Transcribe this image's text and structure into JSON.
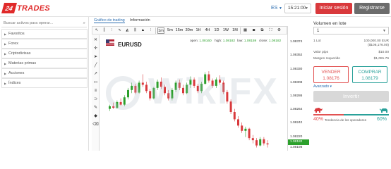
{
  "header": {
    "logo_mark": "24",
    "logo_text": "TRADES",
    "language": "ES",
    "time": "15:21:00",
    "login_label": "Iniciar sesión",
    "register_label": "Registrarse"
  },
  "sidebar": {
    "search_placeholder": "Buscar activos para operar...",
    "categories": [
      "Favoritos",
      "Forex",
      "Criptodivisas",
      "Materias primas",
      "Acciones",
      "Índices"
    ]
  },
  "chart": {
    "tabs": [
      "Gráfico de trading",
      "Información"
    ],
    "active_tab": 0,
    "symbol": "EURUSD",
    "ohlc": {
      "open_label": "open:",
      "open": "1.08160",
      "high_label": "high:",
      "high": "1.08182",
      "low_label": "low:",
      "low": "1.08159",
      "close_label": "close:",
      "close": "1.08182"
    },
    "timeframes": [
      "1m",
      "5m",
      "15m",
      "30m",
      "1H",
      "4H",
      "1D",
      "1W",
      "1M"
    ],
    "price_ticks": [
      "1.08374",
      "1.08352",
      "1.08330",
      "1.08308",
      "1.08286",
      "1.08264",
      "1.08242",
      "1.08220",
      "1.08198"
    ],
    "price_tag": "1.08182",
    "watermark": "WikiFX",
    "candles": [
      [
        1.0825,
        1.08258,
        1.08246,
        1.08255
      ],
      [
        1.08255,
        1.08262,
        1.0825,
        1.08252
      ],
      [
        1.08252,
        1.08266,
        1.0825,
        1.08263
      ],
      [
        1.08263,
        1.0827,
        1.08256,
        1.08258
      ],
      [
        1.08258,
        1.08276,
        1.08255,
        1.08272
      ],
      [
        1.08272,
        1.0829,
        1.08268,
        1.08286
      ],
      [
        1.08286,
        1.083,
        1.0828,
        1.08294
      ],
      [
        1.08294,
        1.08298,
        1.08278,
        1.08281
      ],
      [
        1.08281,
        1.08304,
        1.08279,
        1.083
      ],
      [
        1.083,
        1.08316,
        1.08292,
        1.08296
      ],
      [
        1.08296,
        1.08302,
        1.0828,
        1.08284
      ],
      [
        1.08284,
        1.08288,
        1.08266,
        1.0827
      ],
      [
        1.0827,
        1.08292,
        1.08268,
        1.0829
      ],
      [
        1.0829,
        1.08306,
        1.08286,
        1.08302
      ],
      [
        1.08302,
        1.0831,
        1.08288,
        1.08292
      ],
      [
        1.08292,
        1.08296,
        1.08276,
        1.0828
      ],
      [
        1.0828,
        1.08286,
        1.08266,
        1.0827
      ],
      [
        1.0827,
        1.0829,
        1.08266,
        1.08286
      ],
      [
        1.08286,
        1.08304,
        1.08282,
        1.083
      ],
      [
        1.083,
        1.08306,
        1.08286,
        1.0829
      ],
      [
        1.0829,
        1.08296,
        1.08276,
        1.0828
      ],
      [
        1.0828,
        1.083,
        1.08278,
        1.08296
      ],
      [
        1.08296,
        1.08312,
        1.0829,
        1.08306
      ],
      [
        1.08306,
        1.0831,
        1.0829,
        1.08294
      ],
      [
        1.08294,
        1.08298,
        1.0828,
        1.08284
      ],
      [
        1.08284,
        1.08302,
        1.0828,
        1.08298
      ],
      [
        1.08298,
        1.0832,
        1.08296,
        1.08316
      ],
      [
        1.08316,
        1.08322,
        1.083,
        1.08304
      ],
      [
        1.08304,
        1.08308,
        1.0829,
        1.08294
      ],
      [
        1.08294,
        1.0831,
        1.0829,
        1.08306
      ],
      [
        1.08306,
        1.08314,
        1.08296,
        1.083
      ],
      [
        1.083,
        1.08304,
        1.08278,
        1.08282
      ],
      [
        1.08282,
        1.08286,
        1.0826,
        1.08264
      ],
      [
        1.08264,
        1.08268,
        1.0824,
        1.08244
      ],
      [
        1.08244,
        1.0825,
        1.08226,
        1.0823
      ],
      [
        1.0823,
        1.08236,
        1.08214,
        1.08218
      ],
      [
        1.08218,
        1.08224,
        1.08204,
        1.08208
      ],
      [
        1.08208,
        1.08216,
        1.08196,
        1.08212
      ],
      [
        1.08212,
        1.08214,
        1.0819,
        1.08194
      ],
      [
        1.08194,
        1.082,
        1.08184,
        1.0819
      ],
      [
        1.0819,
        1.08194,
        1.08176,
        1.0818
      ],
      [
        1.0818,
        1.08196,
        1.08178,
        1.08192
      ],
      [
        1.08192,
        1.08196,
        1.0818,
        1.08184
      ],
      [
        1.08184,
        1.0819,
        1.08176,
        1.08182
      ]
    ]
  },
  "panel": {
    "volume_label": "Volumen en lote",
    "volume_value": "1",
    "rows": [
      {
        "label": "1 Lot",
        "value": "100,000.00 EUR\n($108,176.00)"
      },
      {
        "label": "Valor pips",
        "value": "$10.00"
      },
      {
        "label": "Margen requerido",
        "value": "$1,081.76"
      }
    ],
    "sell_label": "VENDER",
    "sell_price": "1.08176",
    "buy_label": "COMPRAR",
    "buy_price": "1.08179",
    "advanced_label": "Avanzado",
    "invest_label": "Invertir",
    "sentiment_label": "Tendencia de los operadores",
    "sell_pct": "40%",
    "buy_pct": "60%",
    "colors": {
      "sell": "#e25252",
      "buy": "#2aa19a",
      "up": "#2ca02c",
      "down": "#d9393c"
    }
  }
}
